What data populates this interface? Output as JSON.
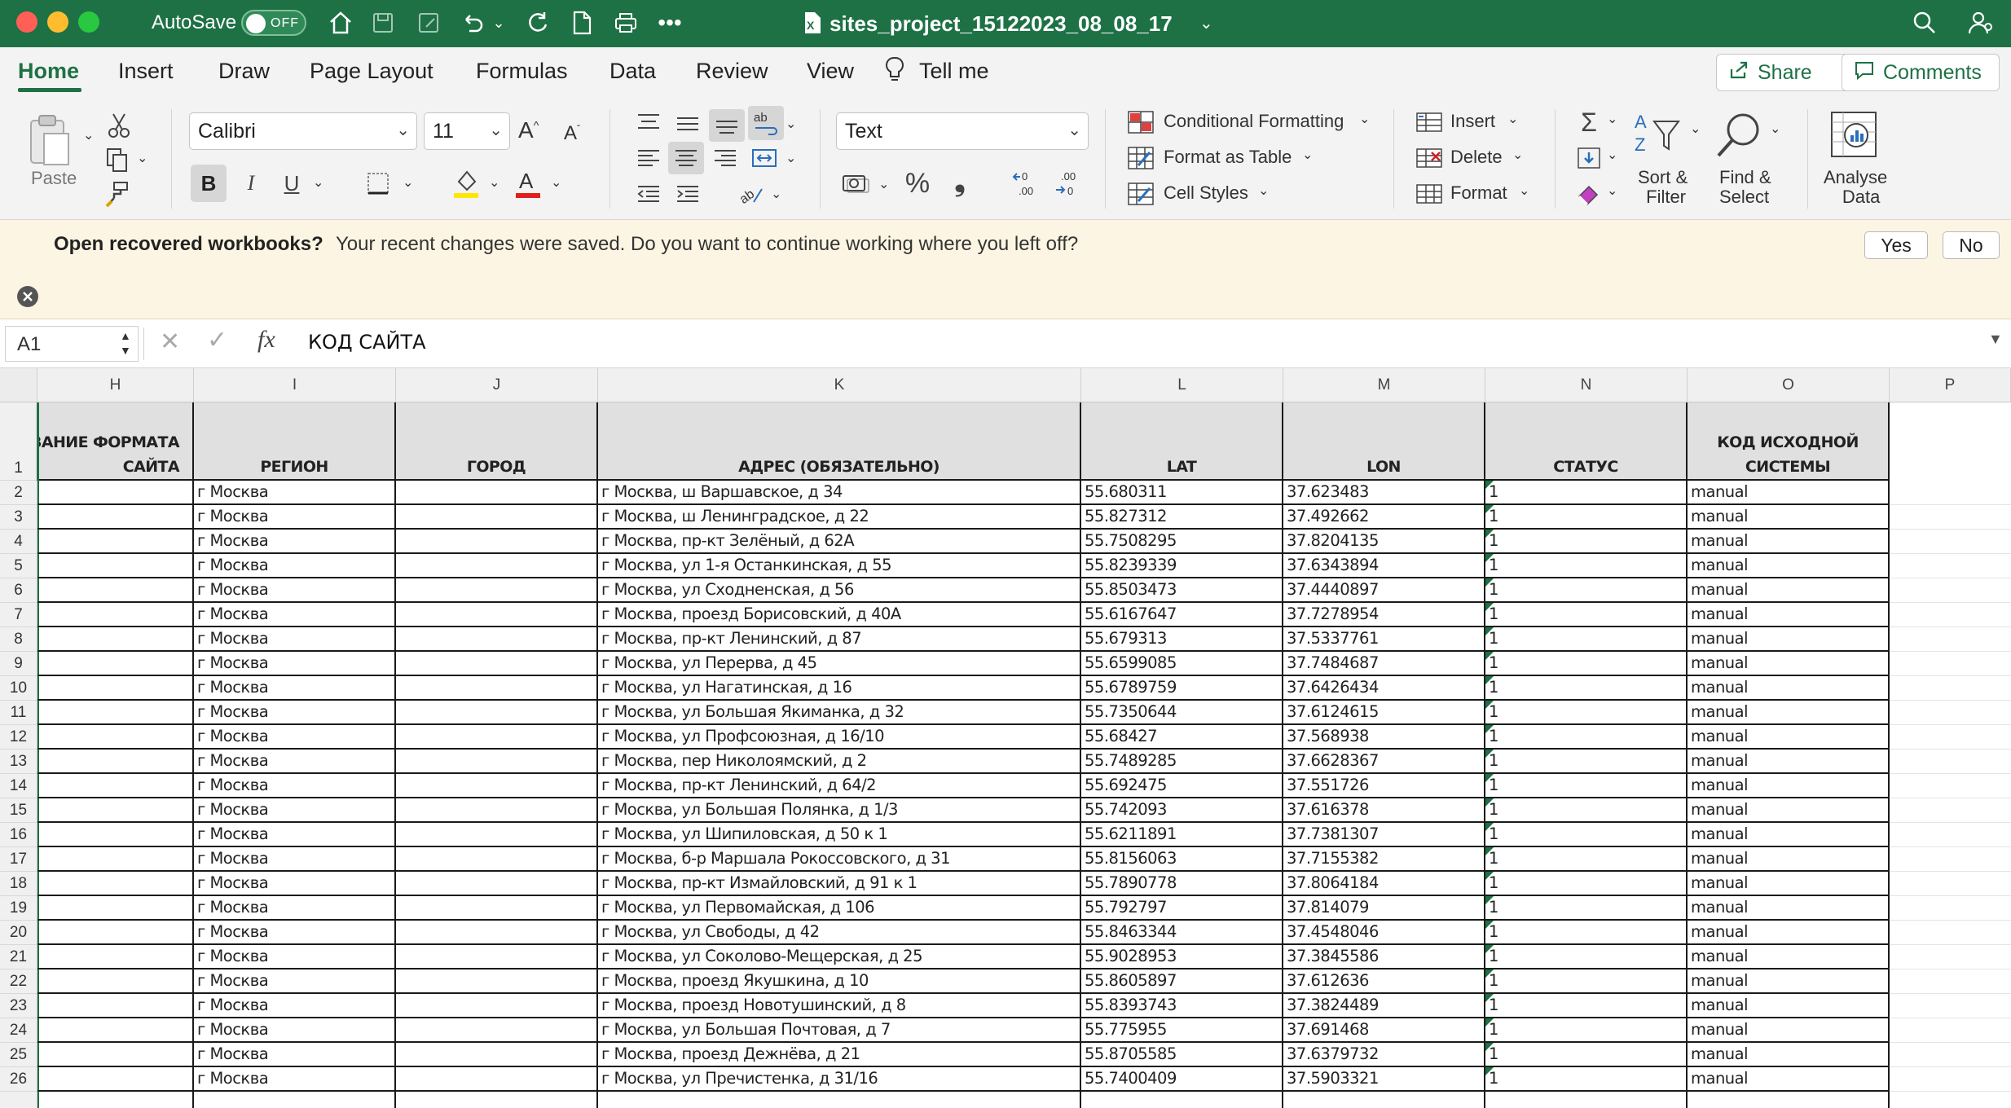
{
  "window": {
    "autosave_label": "AutoSave",
    "autosave_state": "OFF",
    "filename": "sites_project_15122023_08_08_17"
  },
  "tabs": [
    "Home",
    "Insert",
    "Draw",
    "Page Layout",
    "Formulas",
    "Data",
    "Review",
    "View"
  ],
  "tell_me": "Tell me",
  "share_label": "Share",
  "comments_label": "Comments",
  "ribbon": {
    "paste": "Paste",
    "font_name": "Calibri",
    "font_size": "11",
    "number_format": "Text",
    "conditional_formatting": "Conditional Formatting",
    "format_as_table": "Format as Table",
    "cell_styles": "Cell Styles",
    "insert": "Insert",
    "delete": "Delete",
    "format": "Format",
    "sort_filter_1": "Sort &",
    "sort_filter_2": "Filter",
    "find_select_1": "Find &",
    "find_select_2": "Select",
    "analyse_1": "Analyse",
    "analyse_2": "Data",
    "bold": "B",
    "italic": "I",
    "underline": "U",
    "percent": "%",
    "comma": "❟"
  },
  "notification": {
    "title": "Open recovered workbooks?",
    "message": "Your recent changes were saved. Do you want to continue working where you left off?",
    "yes": "Yes",
    "no": "No"
  },
  "formula_bar": {
    "name_box": "A1",
    "fx": "fx",
    "content": "КОД САЙТА"
  },
  "columns": [
    "H",
    "I",
    "J",
    "K",
    "L",
    "M",
    "N",
    "O",
    "P"
  ],
  "headers": {
    "H": [
      "ВАНИЕ ФОРМАТА",
      "САЙТА"
    ],
    "I": [
      "РЕГИОН"
    ],
    "J": [
      "ГОРОД"
    ],
    "K": [
      "АДРЕС (ОБЯЗАТЕЛЬНО)"
    ],
    "L": [
      "LAT"
    ],
    "M": [
      "LON"
    ],
    "N": [
      "СТАТУС"
    ],
    "O": [
      "КОД ИСХОДНОЙ",
      "СИСТЕМЫ"
    ]
  },
  "rows": [
    {
      "n": "2",
      "region": "г Москва",
      "address": "г Москва, ш Варшавское, д 34",
      "lat": "55.680311",
      "lon": "37.623483",
      "status": "1",
      "source": "manual"
    },
    {
      "n": "3",
      "region": "г Москва",
      "address": "г Москва, ш Ленинградское, д 22",
      "lat": "55.827312",
      "lon": "37.492662",
      "status": "1",
      "source": "manual"
    },
    {
      "n": "4",
      "region": "г Москва",
      "address": "г Москва, пр-кт Зелёный, д 62А",
      "lat": "55.7508295",
      "lon": "37.8204135",
      "status": "1",
      "source": "manual"
    },
    {
      "n": "5",
      "region": "г Москва",
      "address": "г Москва, ул 1-я Останкинская, д 55",
      "lat": "55.8239339",
      "lon": "37.6343894",
      "status": "1",
      "source": "manual"
    },
    {
      "n": "6",
      "region": "г Москва",
      "address": "г Москва, ул Сходненская, д 56",
      "lat": "55.8503473",
      "lon": "37.4440897",
      "status": "1",
      "source": "manual"
    },
    {
      "n": "7",
      "region": "г Москва",
      "address": "г Москва, проезд Борисовский, д 40А",
      "lat": "55.6167647",
      "lon": "37.7278954",
      "status": "1",
      "source": "manual"
    },
    {
      "n": "8",
      "region": "г Москва",
      "address": "г Москва, пр-кт Ленинский, д 87",
      "lat": "55.679313",
      "lon": "37.5337761",
      "status": "1",
      "source": "manual"
    },
    {
      "n": "9",
      "region": "г Москва",
      "address": "г Москва, ул Перерва, д 45",
      "lat": "55.6599085",
      "lon": "37.7484687",
      "status": "1",
      "source": "manual"
    },
    {
      "n": "10",
      "region": "г Москва",
      "address": "г Москва, ул Нагатинская, д 16",
      "lat": "55.6789759",
      "lon": "37.6426434",
      "status": "1",
      "source": "manual"
    },
    {
      "n": "11",
      "region": "г Москва",
      "address": "г Москва, ул Большая Якиманка, д 32",
      "lat": "55.7350644",
      "lon": "37.6124615",
      "status": "1",
      "source": "manual"
    },
    {
      "n": "12",
      "region": "г Москва",
      "address": "г Москва, ул Профсоюзная, д 16/10",
      "lat": "55.68427",
      "lon": "37.568938",
      "status": "1",
      "source": "manual"
    },
    {
      "n": "13",
      "region": "г Москва",
      "address": "г Москва, пер Николоямский, д 2",
      "lat": "55.7489285",
      "lon": "37.6628367",
      "status": "1",
      "source": "manual"
    },
    {
      "n": "14",
      "region": "г Москва",
      "address": "г Москва, пр-кт Ленинский, д 64/2",
      "lat": "55.692475",
      "lon": "37.551726",
      "status": "1",
      "source": "manual"
    },
    {
      "n": "15",
      "region": "г Москва",
      "address": "г Москва, ул Большая Полянка, д 1/3",
      "lat": "55.742093",
      "lon": "37.616378",
      "status": "1",
      "source": "manual"
    },
    {
      "n": "16",
      "region": "г Москва",
      "address": "г Москва, ул Шипиловская, д 50 к 1",
      "lat": "55.6211891",
      "lon": "37.7381307",
      "status": "1",
      "source": "manual"
    },
    {
      "n": "17",
      "region": "г Москва",
      "address": "г Москва, б-р Маршала Рокоссовского, д 31",
      "lat": "55.8156063",
      "lon": "37.7155382",
      "status": "1",
      "source": "manual"
    },
    {
      "n": "18",
      "region": "г Москва",
      "address": "г Москва, пр-кт Измайловский, д 91 к 1",
      "lat": "55.7890778",
      "lon": "37.8064184",
      "status": "1",
      "source": "manual"
    },
    {
      "n": "19",
      "region": "г Москва",
      "address": "г Москва, ул Первомайская, д 106",
      "lat": "55.792797",
      "lon": "37.814079",
      "status": "1",
      "source": "manual"
    },
    {
      "n": "20",
      "region": "г Москва",
      "address": "г Москва, ул Свободы, д 42",
      "lat": "55.8463344",
      "lon": "37.4548046",
      "status": "1",
      "source": "manual"
    },
    {
      "n": "21",
      "region": "г Москва",
      "address": "г Москва, ул Соколово-Мещерская, д 25",
      "lat": "55.9028953",
      "lon": "37.3845586",
      "status": "1",
      "source": "manual"
    },
    {
      "n": "22",
      "region": "г Москва",
      "address": "г Москва, проезд Якушкина, д 10",
      "lat": "55.8605897",
      "lon": "37.612636",
      "status": "1",
      "source": "manual"
    },
    {
      "n": "23",
      "region": "г Москва",
      "address": "г Москва, проезд Новотушинский, д 8",
      "lat": "55.8393743",
      "lon": "37.3824489",
      "status": "1",
      "source": "manual"
    },
    {
      "n": "24",
      "region": "г Москва",
      "address": "г Москва, ул Большая Почтовая, д 7",
      "lat": "55.775955",
      "lon": "37.691468",
      "status": "1",
      "source": "manual"
    },
    {
      "n": "25",
      "region": "г Москва",
      "address": "г Москва, проезд Дежнёва, д 21",
      "lat": "55.8705585",
      "lon": "37.6379732",
      "status": "1",
      "source": "manual"
    },
    {
      "n": "26",
      "region": "г Москва",
      "address": "г Москва, ул Пречистенка, д 31/16",
      "lat": "55.7400409",
      "lon": "37.5903321",
      "status": "1",
      "source": "manual"
    }
  ]
}
